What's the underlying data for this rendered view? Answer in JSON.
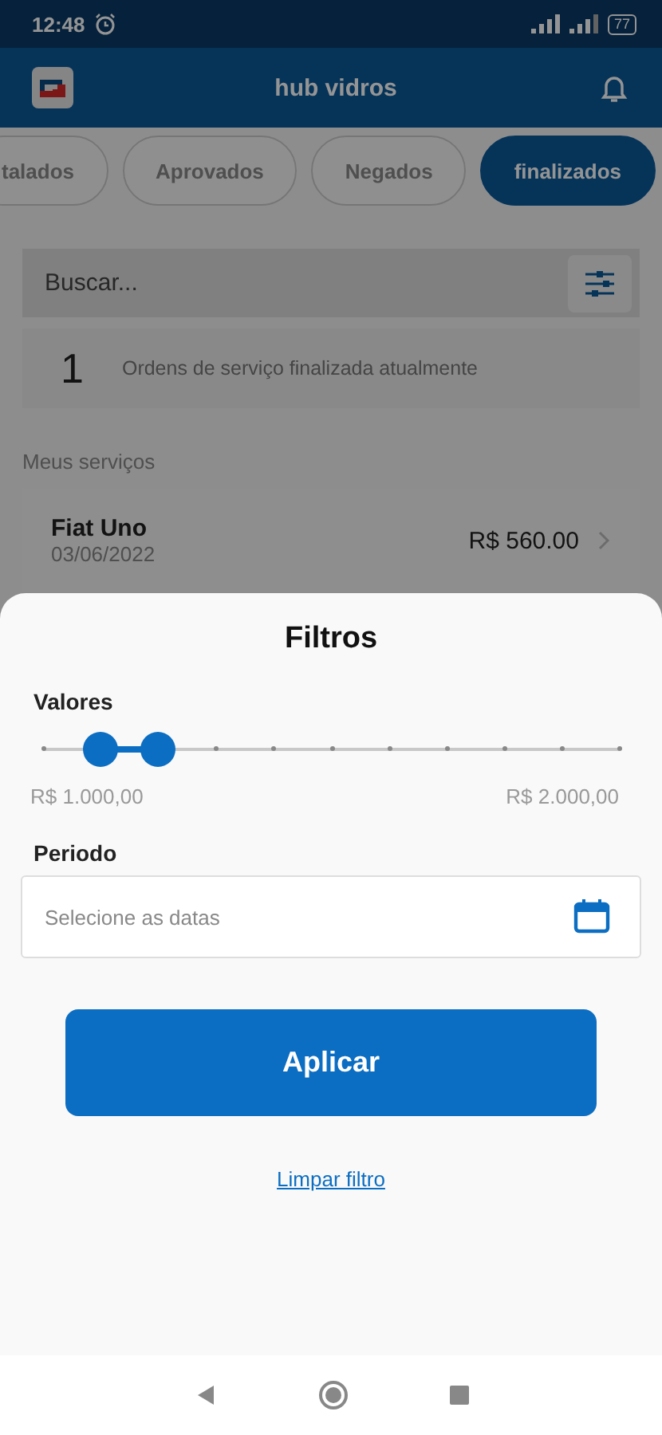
{
  "status_bar": {
    "time": "12:48",
    "battery": "77"
  },
  "app_bar": {
    "title": "hub vidros"
  },
  "tabs": [
    {
      "label": "talados",
      "selected": false
    },
    {
      "label": "Aprovados",
      "selected": false
    },
    {
      "label": "Negados",
      "selected": false
    },
    {
      "label": "finalizados",
      "selected": true
    }
  ],
  "search": {
    "placeholder": "Buscar..."
  },
  "summary": {
    "count": "1",
    "text": "Ordens de serviço finalizada atualmente"
  },
  "section_title": "Meus serviços",
  "services": [
    {
      "name": "Fiat Uno",
      "date": "03/06/2022",
      "price": "R$ 560.00"
    }
  ],
  "filter_sheet": {
    "title": "Filtros",
    "values_label": "Valores",
    "slider": {
      "thumbs": [
        {
          "level": 0.1
        },
        {
          "level": 0.2
        }
      ],
      "min_label": "R$ 1.000,00",
      "max_label": "R$ 2.000,00"
    },
    "period_label": "Periodo",
    "date_field": {
      "placeholder": "Selecione as datas"
    },
    "apply_button": "Aplicar",
    "clear_link": "Limpar filtro"
  }
}
